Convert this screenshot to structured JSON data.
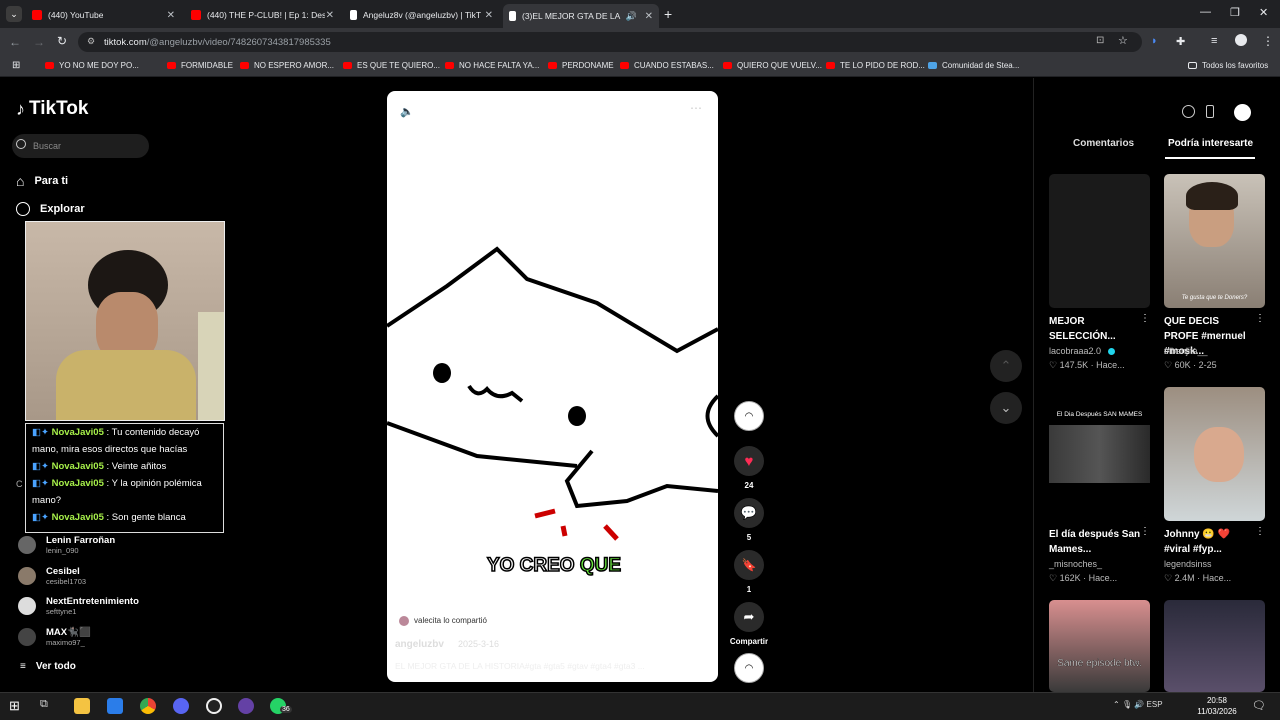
{
  "browser": {
    "tabs": [
      {
        "label": "(440) YouTube",
        "fav_color": "#ff0000"
      },
      {
        "label": "(440) THE P-CLUB! | Ep 1: Desp",
        "fav_color": "#ff0000"
      },
      {
        "label": "Angeluz8v (@angeluzbv) | TikT",
        "fav_color": "#ffffff"
      },
      {
        "label": "(3)EL MEJOR GTA DE LA HI",
        "fav_color": "#ffffff"
      }
    ],
    "url_host": "tiktok.com",
    "url_path": "/@angeluzbv/video/7482607343817985335",
    "bookmarks": [
      "YO NO ME DOY PO...",
      "FORMIDABLE",
      "NO ESPERO AMOR...",
      "ES QUE TE QUIERO...",
      "NO HACE FALTA YA...",
      "PERDONAME",
      "CUANDO ESTABAS...",
      "QUIERO QUE VUELV...",
      "TE LO PIDO DE ROD...",
      "Comunidad de Stea..."
    ],
    "all_favorites": "Todos los favoritos"
  },
  "tiktok": {
    "logo": "TikTok",
    "search_placeholder": "Buscar",
    "nav": [
      {
        "label": "Para ti",
        "icon": "home-icon"
      },
      {
        "label": "Explorar",
        "icon": "compass-icon"
      }
    ],
    "side_letter": "C",
    "following": [
      {
        "name": "Lenin Farroñan",
        "user": "lenin_090"
      },
      {
        "name": "Cesibel",
        "user": "cesibel1703"
      },
      {
        "name": "NextEntretenimiento",
        "user": "sefttyne1"
      },
      {
        "name": "MAX🐈‍⬛⬛",
        "user": "maximo97_"
      }
    ],
    "see_all": "Ver todo"
  },
  "chat": [
    {
      "user": "NovaJavi05",
      "msg": " : Tu contenido decayó mano, mira esos directos que hacías"
    },
    {
      "user": "NovaJavi05",
      "msg": " : Veinte añitos"
    },
    {
      "user": "NovaJavi05",
      "msg": " : Y la opinión polémica mano?"
    },
    {
      "user": "NovaJavi05",
      "msg": " : Son gente blanca"
    }
  ],
  "video": {
    "caption_a": "YO CREO ",
    "caption_b": "QUE",
    "shared_by": "valecita lo compartió",
    "author": "angeluzbv",
    "date": "2025-3-16",
    "description": "EL MEJOR GTA DE LA HISTORIA#gta #gta5 #gtav #gta4 #gta3 ...",
    "more": "más",
    "likes": "24",
    "comments": "5",
    "saves": "1",
    "share": "Compartir"
  },
  "panel": {
    "tab_comments": "Comentarios",
    "tab_interest": "Podría interesarte",
    "cards": [
      {
        "title": "MEJOR SELECCIÓN...",
        "user": "lacobraaa2.0",
        "stat": "147.5K · Hace...",
        "overlay": ""
      },
      {
        "title": "QUE DECIS PROFE #mernuel #mosk...",
        "user": "elbenjita__",
        "stat": "60K · 2-25",
        "overlay": "Te gusta que te Doners?"
      },
      {
        "title": "El día después San Mames...",
        "user": "_misnoches_",
        "stat": "162K · Hace...",
        "overlay": "El Dia Después SAN MAMES"
      },
      {
        "title": "Johnny 😬 ❤️ #viral #fyp...",
        "user": "legendsinss",
        "stat": "2.4M · Hace...",
        "overlay": ""
      },
      {
        "title": "",
        "user": "",
        "stat": "",
        "overlay": "Same episode btw."
      },
      {
        "title": "",
        "user": "",
        "stat": "",
        "overlay": ""
      }
    ]
  },
  "taskbar": {
    "lang": "ESP",
    "time": "20:58",
    "date": "11/03/2026",
    "notif": "36"
  }
}
